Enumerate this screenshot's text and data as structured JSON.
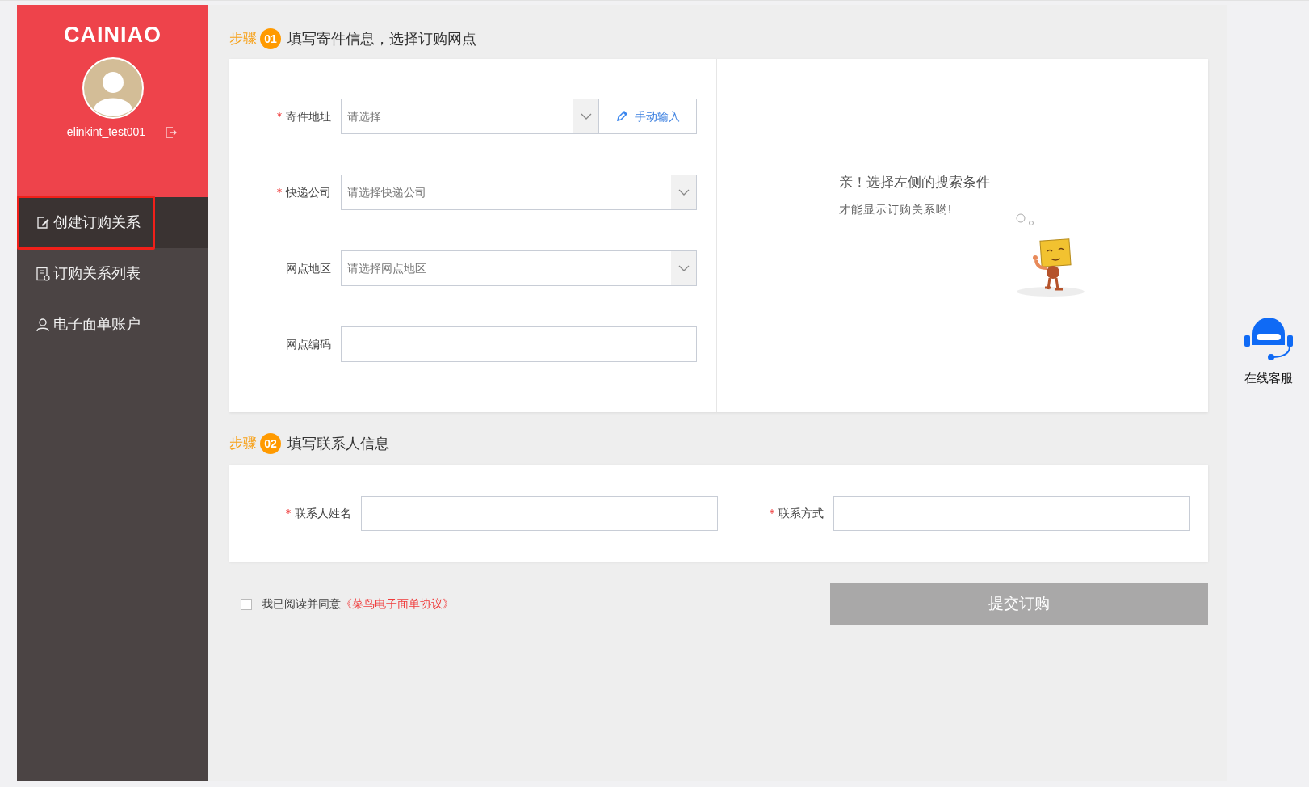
{
  "sidebar": {
    "brand": "CAINIAO",
    "username": "elinkint_test001",
    "items": [
      {
        "label": "创建订购关系",
        "selected": true
      },
      {
        "label": "订购关系列表",
        "selected": false
      },
      {
        "label": "电子面单账户",
        "selected": false
      }
    ]
  },
  "step1": {
    "step_word": "步骤",
    "number": "01",
    "title": "填写寄件信息，选择订购网点",
    "fields": [
      {
        "kind": "select_manual",
        "required": true,
        "label": "寄件地址",
        "placeholder": "请选择",
        "button": "手动输入"
      },
      {
        "kind": "select",
        "required": true,
        "label": "快递公司",
        "placeholder": "请选择快递公司"
      },
      {
        "kind": "select",
        "required": false,
        "label": "网点地区",
        "placeholder": "请选择网点地区"
      },
      {
        "kind": "input",
        "required": false,
        "label": "网点编码"
      }
    ],
    "empty_state": {
      "title": "亲！选择左侧的搜索条件",
      "subtitle": "才能显示订购关系哟!"
    }
  },
  "step2": {
    "step_word": "步骤",
    "number": "02",
    "title": "填写联系人信息",
    "fields": [
      {
        "required": true,
        "label": "联系人姓名"
      },
      {
        "required": true,
        "label": "联系方式"
      }
    ]
  },
  "agreement": {
    "checked": false,
    "text": "我已阅读并同意",
    "link": "《菜鸟电子面单协议》"
  },
  "submit": {
    "label": "提交订购",
    "disabled": true
  },
  "service": {
    "label": "在线客服"
  }
}
